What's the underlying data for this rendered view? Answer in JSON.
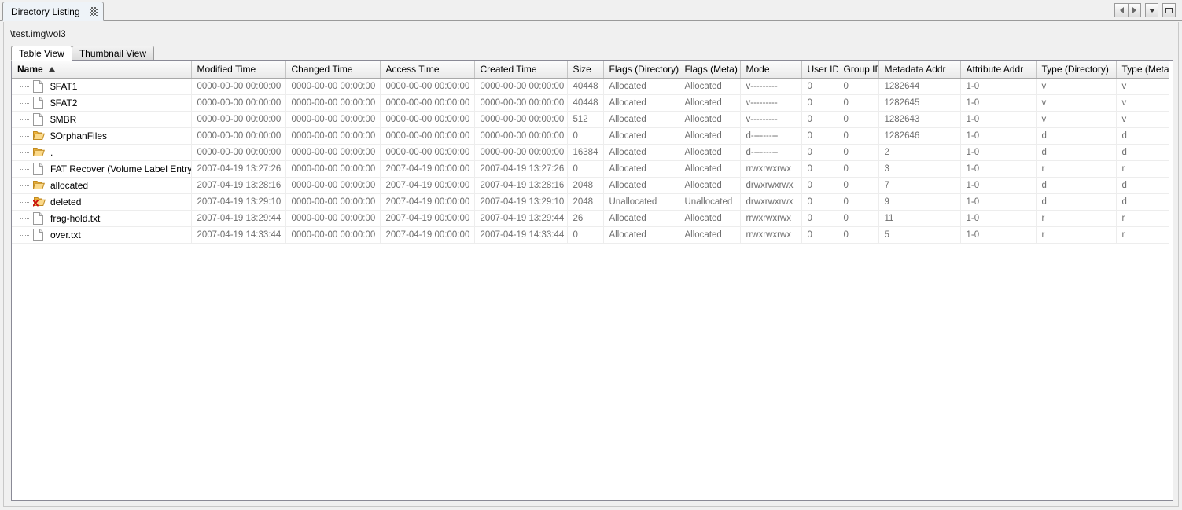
{
  "window": {
    "tab_title": "Directory Listing",
    "close_icon": "close-x-icon",
    "controls": {
      "prev_icon": "arrow-left-icon",
      "next_icon": "arrow-right-icon",
      "dropdown_icon": "chevron-down-icon",
      "maximize_icon": "maximize-icon"
    }
  },
  "path": "\\test.img\\vol3",
  "view_tabs": [
    {
      "label": "Table View",
      "active": true
    },
    {
      "label": "Thumbnail View",
      "active": false
    }
  ],
  "table": {
    "sort_column": "Name",
    "sort_direction": "ascending",
    "sort_icon": "sort-ascending-icon",
    "columns": [
      "Name",
      "Modified Time",
      "Changed Time",
      "Access Time",
      "Created Time",
      "Size",
      "Flags (Directory)",
      "Flags (Meta)",
      "Mode",
      "User ID",
      "Group ID",
      "Metadata Addr",
      "Attribute Addr",
      "Type (Directory)",
      "Type (Meta)"
    ],
    "rows": [
      {
        "icon": "file-icon",
        "name": "$FAT1",
        "modified_time": "0000-00-00 00:00:00",
        "changed_time": "0000-00-00 00:00:00",
        "access_time": "0000-00-00 00:00:00",
        "created_time": "0000-00-00 00:00:00",
        "size": "40448",
        "flags_directory": "Allocated",
        "flags_meta": "Allocated",
        "mode": "v---------",
        "user_id": "0",
        "group_id": "0",
        "metadata_addr": "1282644",
        "attribute_addr": "1-0",
        "type_directory": "v",
        "type_meta": "v"
      },
      {
        "icon": "file-icon",
        "name": "$FAT2",
        "modified_time": "0000-00-00 00:00:00",
        "changed_time": "0000-00-00 00:00:00",
        "access_time": "0000-00-00 00:00:00",
        "created_time": "0000-00-00 00:00:00",
        "size": "40448",
        "flags_directory": "Allocated",
        "flags_meta": "Allocated",
        "mode": "v---------",
        "user_id": "0",
        "group_id": "0",
        "metadata_addr": "1282645",
        "attribute_addr": "1-0",
        "type_directory": "v",
        "type_meta": "v"
      },
      {
        "icon": "file-icon",
        "name": "$MBR",
        "modified_time": "0000-00-00 00:00:00",
        "changed_time": "0000-00-00 00:00:00",
        "access_time": "0000-00-00 00:00:00",
        "created_time": "0000-00-00 00:00:00",
        "size": "512",
        "flags_directory": "Allocated",
        "flags_meta": "Allocated",
        "mode": "v---------",
        "user_id": "0",
        "group_id": "0",
        "metadata_addr": "1282643",
        "attribute_addr": "1-0",
        "type_directory": "v",
        "type_meta": "v"
      },
      {
        "icon": "folder-icon",
        "name": "$OrphanFiles",
        "modified_time": "0000-00-00 00:00:00",
        "changed_time": "0000-00-00 00:00:00",
        "access_time": "0000-00-00 00:00:00",
        "created_time": "0000-00-00 00:00:00",
        "size": "0",
        "flags_directory": "Allocated",
        "flags_meta": "Allocated",
        "mode": "d---------",
        "user_id": "0",
        "group_id": "0",
        "metadata_addr": "1282646",
        "attribute_addr": "1-0",
        "type_directory": "d",
        "type_meta": "d"
      },
      {
        "icon": "folder-icon",
        "name": ".",
        "modified_time": "0000-00-00 00:00:00",
        "changed_time": "0000-00-00 00:00:00",
        "access_time": "0000-00-00 00:00:00",
        "created_time": "0000-00-00 00:00:00",
        "size": "16384",
        "flags_directory": "Allocated",
        "flags_meta": "Allocated",
        "mode": "d---------",
        "user_id": "0",
        "group_id": "0",
        "metadata_addr": "2",
        "attribute_addr": "1-0",
        "type_directory": "d",
        "type_meta": "d"
      },
      {
        "icon": "file-icon",
        "name": "FAT Recover (Volume Label Entry)",
        "modified_time": "2007-04-19 13:27:26",
        "changed_time": "0000-00-00 00:00:00",
        "access_time": "2007-04-19 00:00:00",
        "created_time": "2007-04-19 13:27:26",
        "size": "0",
        "flags_directory": "Allocated",
        "flags_meta": "Allocated",
        "mode": "rrwxrwxrwx",
        "user_id": "0",
        "group_id": "0",
        "metadata_addr": "3",
        "attribute_addr": "1-0",
        "type_directory": "r",
        "type_meta": "r"
      },
      {
        "icon": "folder-icon",
        "name": "allocated",
        "modified_time": "2007-04-19 13:28:16",
        "changed_time": "0000-00-00 00:00:00",
        "access_time": "2007-04-19 00:00:00",
        "created_time": "2007-04-19 13:28:16",
        "size": "2048",
        "flags_directory": "Allocated",
        "flags_meta": "Allocated",
        "mode": "drwxrwxrwx",
        "user_id": "0",
        "group_id": "0",
        "metadata_addr": "7",
        "attribute_addr": "1-0",
        "type_directory": "d",
        "type_meta": "d"
      },
      {
        "icon": "folder-deleted-icon",
        "name": "deleted",
        "modified_time": "2007-04-19 13:29:10",
        "changed_time": "0000-00-00 00:00:00",
        "access_time": "2007-04-19 00:00:00",
        "created_time": "2007-04-19 13:29:10",
        "size": "2048",
        "flags_directory": "Unallocated",
        "flags_meta": "Unallocated",
        "mode": "drwxrwxrwx",
        "user_id": "0",
        "group_id": "0",
        "metadata_addr": "9",
        "attribute_addr": "1-0",
        "type_directory": "d",
        "type_meta": "d"
      },
      {
        "icon": "file-icon",
        "name": "frag-hold.txt",
        "modified_time": "2007-04-19 13:29:44",
        "changed_time": "0000-00-00 00:00:00",
        "access_time": "2007-04-19 00:00:00",
        "created_time": "2007-04-19 13:29:44",
        "size": "26",
        "flags_directory": "Allocated",
        "flags_meta": "Allocated",
        "mode": "rrwxrwxrwx",
        "user_id": "0",
        "group_id": "0",
        "metadata_addr": "11",
        "attribute_addr": "1-0",
        "type_directory": "r",
        "type_meta": "r"
      },
      {
        "icon": "file-icon",
        "name": "over.txt",
        "modified_time": "2007-04-19 14:33:44",
        "changed_time": "0000-00-00 00:00:00",
        "access_time": "2007-04-19 00:00:00",
        "created_time": "2007-04-19 14:33:44",
        "size": "0",
        "flags_directory": "Allocated",
        "flags_meta": "Allocated",
        "mode": "rrwxrwxrwx",
        "user_id": "0",
        "group_id": "0",
        "metadata_addr": "5",
        "attribute_addr": "1-0",
        "type_directory": "r",
        "type_meta": "r"
      }
    ]
  },
  "colors": {
    "window_bg": "#f0f0f0",
    "tab_active": "#eef3f8",
    "grid_text": "#6f6f6f",
    "folder": "#f5c453",
    "deleted_mark": "#cc1111"
  }
}
